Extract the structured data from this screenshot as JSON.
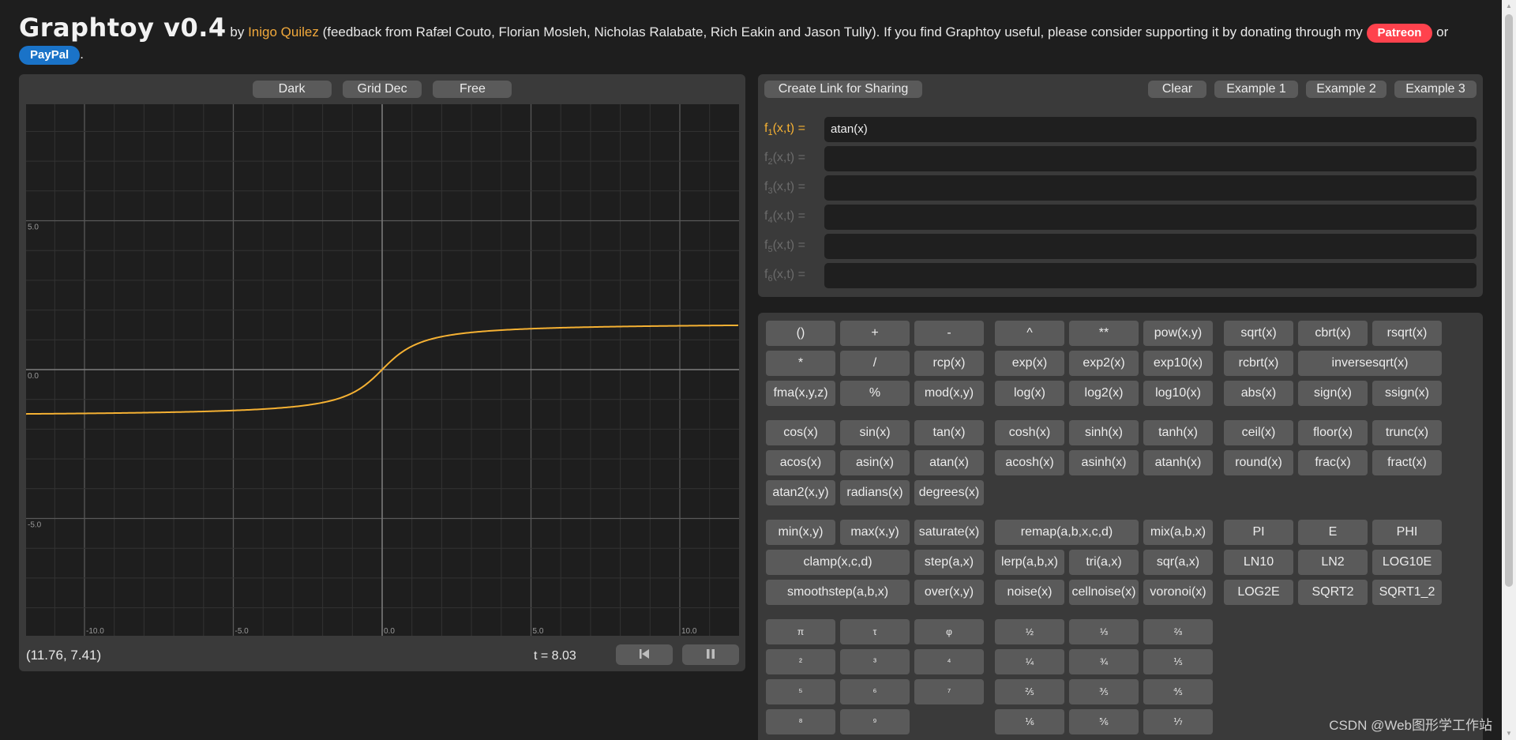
{
  "header": {
    "title": "Graphtoy v0.4",
    "by": " by ",
    "author": "Inigo Quilez",
    "text": " (feedback from Rafæl Couto, Florian Mosleh, Nicholas Ralabate, Rich Eakin and Jason Tully). If you find Graphtoy useful, please consider supporting it by donating through my ",
    "patreon": "Patreon",
    "or": " or ",
    "paypal": "PayPal",
    "period": "."
  },
  "graph": {
    "buttons": [
      "Dark",
      "Grid Dec",
      "Free"
    ],
    "coords": "(11.76, 7.41)",
    "time": "t = 8.03",
    "x_labels": [
      "-10.0",
      "-5.0",
      "0.0",
      "5.0",
      "10.0"
    ],
    "y_labels": [
      "5.0",
      "0.0",
      "-5.0"
    ],
    "curve_color": "#f5b133"
  },
  "functions": {
    "share": "Create Link for Sharing",
    "clear": "Clear",
    "examples": [
      "Example 1",
      "Example 2",
      "Example 3"
    ],
    "rows": [
      {
        "label": "f",
        "sub": "1",
        "suffix": "(x,t) =",
        "value": "atan(x)"
      },
      {
        "label": "f",
        "sub": "2",
        "suffix": "(x,t) =",
        "value": ""
      },
      {
        "label": "f",
        "sub": "3",
        "suffix": "(x,t) =",
        "value": ""
      },
      {
        "label": "f",
        "sub": "4",
        "suffix": "(x,t) =",
        "value": ""
      },
      {
        "label": "f",
        "sub": "5",
        "suffix": "(x,t) =",
        "value": ""
      },
      {
        "label": "f",
        "sub": "6",
        "suffix": "(x,t) =",
        "value": ""
      }
    ]
  },
  "keypad": {
    "keys": [
      [
        "()",
        "+",
        "-",
        "^",
        "**",
        "pow(x,y)",
        "sqrt(x)",
        "cbrt(x)",
        "rsqrt(x)"
      ],
      [
        "*",
        "/",
        "rcp(x)",
        "exp(x)",
        "exp2(x)",
        "exp10(x)",
        "rcbrt(x)",
        "inversesqrt(x)"
      ],
      [
        "fma(x,y,z)",
        "%",
        "mod(x,y)",
        "log(x)",
        "log2(x)",
        "log10(x)",
        "abs(x)",
        "sign(x)",
        "ssign(x)"
      ],
      [
        "cos(x)",
        "sin(x)",
        "tan(x)",
        "cosh(x)",
        "sinh(x)",
        "tanh(x)",
        "ceil(x)",
        "floor(x)",
        "trunc(x)"
      ],
      [
        "acos(x)",
        "asin(x)",
        "atan(x)",
        "acosh(x)",
        "asinh(x)",
        "atanh(x)",
        "round(x)",
        "frac(x)",
        "fract(x)"
      ],
      [
        "atan2(x,y)",
        "radians(x)",
        "degrees(x)"
      ],
      [
        "min(x,y)",
        "max(x,y)",
        "saturate(x)",
        "remap(a,b,x,c,d)",
        "mix(a,b,x)",
        "PI",
        "E",
        "PHI"
      ],
      [
        "clamp(x,c,d)",
        "step(a,x)",
        "lerp(a,b,x)",
        "tri(a,x)",
        "sqr(a,x)",
        "LN10",
        "LN2",
        "LOG10E"
      ],
      [
        "smoothstep(a,b,x)",
        "over(x,y)",
        "noise(x)",
        "cellnoise(x)",
        "voronoi(x)",
        "LOG2E",
        "SQRT2",
        "SQRT1_2"
      ],
      [
        "π",
        "τ",
        "φ",
        "½",
        "⅓",
        "⅔"
      ],
      [
        "²",
        "³",
        "⁴",
        "¼",
        "¾",
        "⅕"
      ],
      [
        "⁵",
        "⁶",
        "⁷",
        "⅖",
        "⅗",
        "⅘"
      ],
      [
        "⁸",
        "⁹",
        "⅙",
        "⅚",
        "⅐"
      ]
    ]
  },
  "watermark": "CSDN @Web图形学工作站"
}
